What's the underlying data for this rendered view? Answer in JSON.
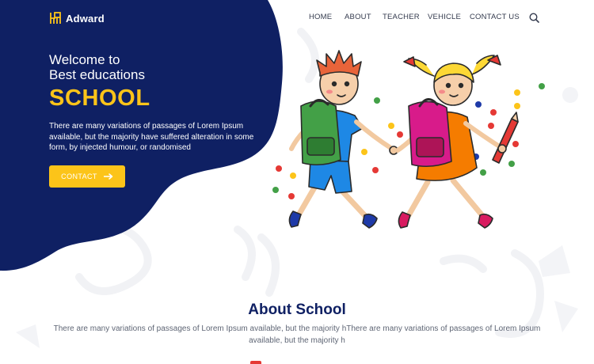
{
  "brand": {
    "name": "Adward",
    "icon": "school-desk-icon"
  },
  "nav": {
    "items": [
      "HOME",
      "ABOUT",
      "TEACHER",
      "VEHICLE",
      "CONTACT US"
    ],
    "search_icon": "search-icon"
  },
  "hero": {
    "line1": "Welcome to",
    "line2": "Best educations",
    "highlight": "SCHOOL",
    "description": "There are many variations of passages of Lorem Ipsum available, but the majority have suffered alteration in some form, by injected humour, or randomised",
    "button_label": "CONTACT",
    "button_icon": "arrow-right-icon"
  },
  "about": {
    "title": "About School",
    "description": "There are many variations of passages of Lorem Ipsum available, but the majority hThere are many variations of passages of Lorem Ipsum available, but the majority h"
  },
  "colors": {
    "navy": "#0f2063",
    "accent": "#fcc419",
    "nav_text": "#333a4d",
    "body_text": "#5f6675"
  }
}
